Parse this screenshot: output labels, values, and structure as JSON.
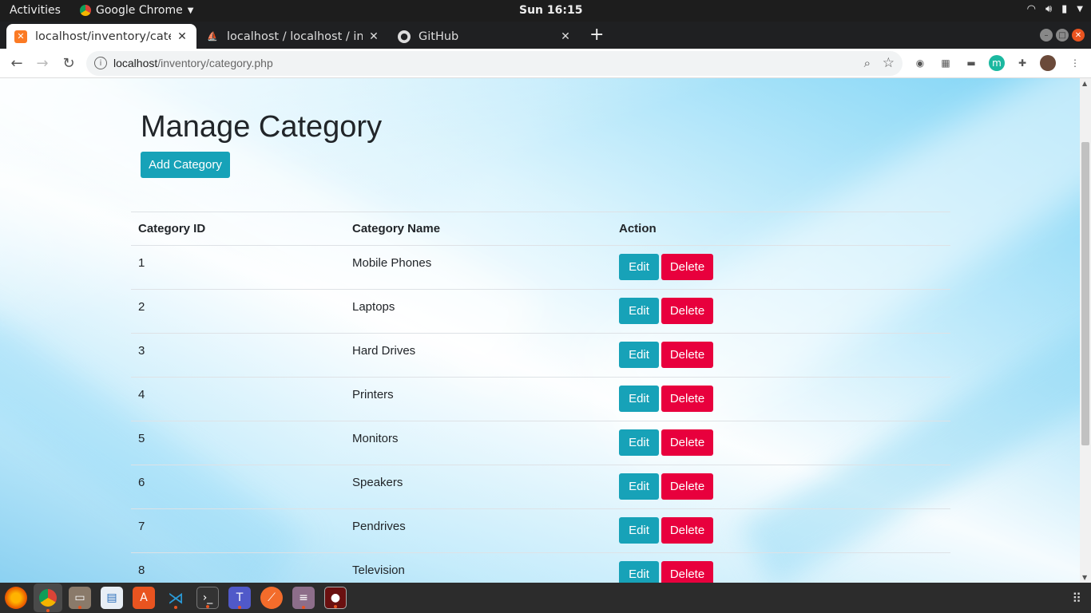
{
  "system": {
    "activities": "Activities",
    "app_name": "Google Chrome",
    "clock": "Sun 16:15"
  },
  "browser": {
    "tabs": [
      {
        "title": "localhost/inventory/categ",
        "icon": "xampp-icon",
        "active": true
      },
      {
        "title": "localhost / localhost / inve",
        "icon": "phpmyadmin-icon",
        "active": false
      },
      {
        "title": "GitHub",
        "icon": "github-icon",
        "active": false
      }
    ],
    "url_host": "localhost",
    "url_path": "/inventory/category.php"
  },
  "page": {
    "title": "Manage Category",
    "add_button": "Add Category",
    "columns": [
      "Category ID",
      "Category Name",
      "Action"
    ],
    "edit_label": "Edit",
    "delete_label": "Delete",
    "rows": [
      {
        "id": "1",
        "name": "Mobile Phones"
      },
      {
        "id": "2",
        "name": "Laptops"
      },
      {
        "id": "3",
        "name": "Hard Drives"
      },
      {
        "id": "4",
        "name": "Printers"
      },
      {
        "id": "5",
        "name": "Monitors"
      },
      {
        "id": "6",
        "name": "Speakers"
      },
      {
        "id": "7",
        "name": "Pendrives"
      },
      {
        "id": "8",
        "name": "Television"
      }
    ]
  },
  "colors": {
    "edit": "#17a2b8",
    "delete": "#e8003d"
  }
}
